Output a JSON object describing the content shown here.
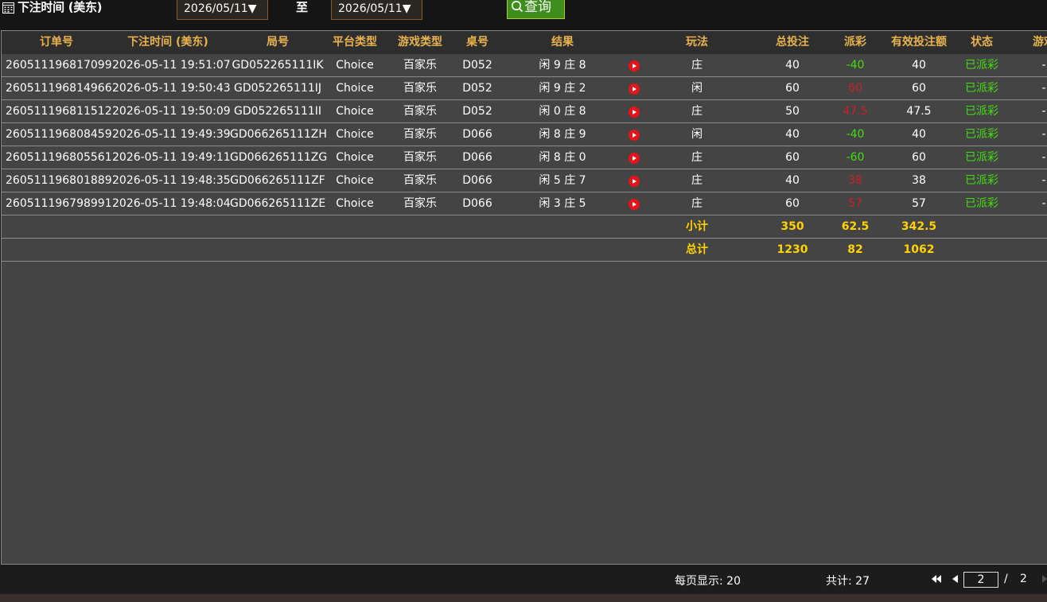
{
  "filter": {
    "label": "下注时间 (美东)",
    "date_from": "2026/05/11▼",
    "to_label": "至",
    "date_to": "2026/05/11▼",
    "query_label": "查询"
  },
  "columns": [
    "订单号",
    "下注时间 (美东)",
    "局号",
    "平台类型",
    "游戏类型",
    "桌号",
    "结果",
    "",
    "玩法",
    "总投注",
    "派彩",
    "有效投注额",
    "状态",
    "游戏"
  ],
  "rows": [
    {
      "order": "260511196817099",
      "time": "2026-05-11 19:51:07",
      "round": "GD052265111IK",
      "platform": "Choice",
      "game": "百家乐",
      "table": "D052",
      "result": "闲 9 庄 8",
      "bet_type": "庄",
      "total": "40",
      "payout": "-40",
      "payout_color": "green",
      "valid": "40",
      "status": "已派彩",
      "extra": "-"
    },
    {
      "order": "260511196814966",
      "time": "2026-05-11 19:50:43",
      "round": "GD052265111IJ",
      "platform": "Choice",
      "game": "百家乐",
      "table": "D052",
      "result": "闲 9 庄 2",
      "bet_type": "闲",
      "total": "60",
      "payout": "60",
      "payout_color": "red",
      "valid": "60",
      "status": "已派彩",
      "extra": "-"
    },
    {
      "order": "260511196811512",
      "time": "2026-05-11 19:50:09",
      "round": "GD052265111II",
      "platform": "Choice",
      "game": "百家乐",
      "table": "D052",
      "result": "闲 0 庄 8",
      "bet_type": "庄",
      "total": "50",
      "payout": "47.5",
      "payout_color": "red",
      "valid": "47.5",
      "status": "已派彩",
      "extra": "-"
    },
    {
      "order": "260511196808459",
      "time": "2026-05-11 19:49:39",
      "round": "GD066265111ZH",
      "platform": "Choice",
      "game": "百家乐",
      "table": "D066",
      "result": "闲 8 庄 9",
      "bet_type": "闲",
      "total": "40",
      "payout": "-40",
      "payout_color": "green",
      "valid": "40",
      "status": "已派彩",
      "extra": "-"
    },
    {
      "order": "260511196805561",
      "time": "2026-05-11 19:49:11",
      "round": "GD066265111ZG",
      "platform": "Choice",
      "game": "百家乐",
      "table": "D066",
      "result": "闲 8 庄 0",
      "bet_type": "庄",
      "total": "60",
      "payout": "-60",
      "payout_color": "green",
      "valid": "60",
      "status": "已派彩",
      "extra": "-"
    },
    {
      "order": "260511196801889",
      "time": "2026-05-11 19:48:35",
      "round": "GD066265111ZF",
      "platform": "Choice",
      "game": "百家乐",
      "table": "D066",
      "result": "闲 5 庄 7",
      "bet_type": "庄",
      "total": "40",
      "payout": "38",
      "payout_color": "red",
      "valid": "38",
      "status": "已派彩",
      "extra": "-"
    },
    {
      "order": "260511196798991",
      "time": "2026-05-11 19:48:04",
      "round": "GD066265111ZE",
      "platform": "Choice",
      "game": "百家乐",
      "table": "D066",
      "result": "闲 3 庄 5",
      "bet_type": "庄",
      "total": "60",
      "payout": "57",
      "payout_color": "red",
      "valid": "57",
      "status": "已派彩",
      "extra": "-"
    }
  ],
  "subtotal": {
    "label": "小计",
    "total": "350",
    "payout": "62.5",
    "valid": "342.5"
  },
  "grandtotal": {
    "label": "总计",
    "total": "1230",
    "payout": "82",
    "valid": "1062"
  },
  "footer": {
    "per_page": "每页显示: 20",
    "total_count": "共计: 27",
    "current_page": "2",
    "separator": "/",
    "total_pages": "2"
  },
  "colors": {
    "header_text": "#e8b24d",
    "win_green": "#44dd11",
    "loss_red": "#c8202c",
    "subtotal_yellow": "#ffd200",
    "query_green": "#3e8e1e"
  }
}
